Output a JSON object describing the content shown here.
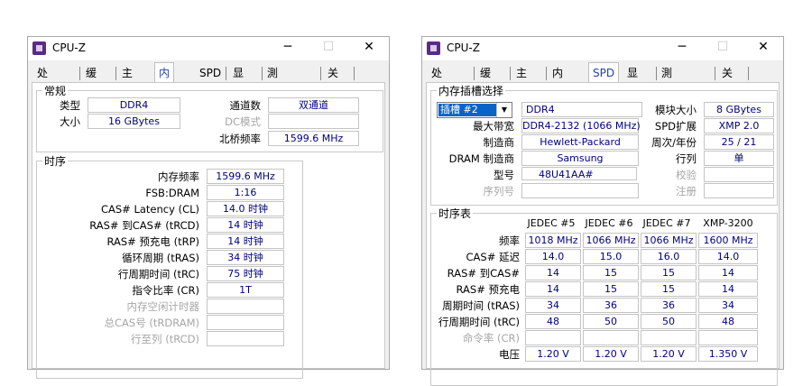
{
  "app": {
    "title": "CPU-Z"
  },
  "controls": {
    "minimize": "─",
    "maximize": "☐",
    "close": "✕"
  },
  "left": {
    "tabs": [
      "处理器",
      "缓存",
      "主板",
      "内存",
      "SPD",
      "显卡",
      "測試分數",
      "关于"
    ],
    "active_tab": "内存",
    "general": {
      "title": "常规",
      "type_label": "类型",
      "type_value": "DDR4",
      "size_label": "大小",
      "size_value": "16 GBytes",
      "channels_label": "通道数",
      "channels_value": "双通道",
      "dc_label": "DC模式",
      "dc_value": "",
      "nb_label": "北桥频率",
      "nb_value": "1599.6 MHz"
    },
    "timings": {
      "title": "时序",
      "rows": [
        {
          "label": "内存频率",
          "value": "1599.6 MHz"
        },
        {
          "label": "FSB:DRAM",
          "value": "1:16"
        },
        {
          "label": "CAS# Latency (CL)",
          "value": "14.0 时钟"
        },
        {
          "label": "RAS# 到CAS# (tRCD)",
          "value": "14 时钟"
        },
        {
          "label": "RAS# 预充电 (tRP)",
          "value": "14 时钟"
        },
        {
          "label": "循环周期 (tRAS)",
          "value": "34 时钟"
        },
        {
          "label": "行周期时间 (tRC)",
          "value": "75 时钟"
        },
        {
          "label": "指令比率 (CR)",
          "value": "1T"
        },
        {
          "label": "内存空闲计时器",
          "value": ""
        },
        {
          "label": "总CAS号 (tRDRAM)",
          "value": ""
        },
        {
          "label": "行至列 (tRCD)",
          "value": ""
        }
      ]
    }
  },
  "right": {
    "tabs": [
      "处理器",
      "缓存",
      "主板",
      "内存",
      "SPD",
      "显卡",
      "測試分數",
      "关于"
    ],
    "active_tab": "SPD",
    "slot": {
      "title": "内存插槽选择",
      "selected": "插槽 #2",
      "type_value": "DDR4",
      "module_size_label": "模块大小",
      "module_size_value": "8 GBytes",
      "bandwidth_label": "最大带宽",
      "bandwidth_value": "DDR4-2132 (1066 MHz)",
      "spd_ext_label": "SPD扩展",
      "spd_ext_value": "XMP 2.0",
      "manufacturer_label": "制造商",
      "manufacturer_value": "Hewlett-Packard",
      "week_year_label": "周次/年份",
      "week_year_value": "25 / 21",
      "dram_mfr_label": "DRAM 制造商",
      "dram_mfr_value": "Samsung",
      "ranks_label": "行列",
      "ranks_value": "单",
      "part_label": "型号",
      "part_value": "48U41AA#",
      "check_label": "校验",
      "check_value": "",
      "serial_label": "序列号",
      "serial_value": "",
      "reg_label": "注册",
      "reg_value": ""
    },
    "timing_table": {
      "title": "时序表",
      "columns": [
        "JEDEC #5",
        "JEDEC #6",
        "JEDEC #7",
        "XMP-3200"
      ],
      "rows": [
        {
          "label": "频率",
          "values": [
            "1018 MHz",
            "1066 MHz",
            "1066 MHz",
            "1600 MHz"
          ],
          "disabled": false
        },
        {
          "label": "CAS# 延迟",
          "values": [
            "14.0",
            "15.0",
            "16.0",
            "14.0"
          ],
          "disabled": false
        },
        {
          "label": "RAS# 到CAS#",
          "values": [
            "14",
            "15",
            "15",
            "14"
          ],
          "disabled": false
        },
        {
          "label": "RAS# 预充电",
          "values": [
            "14",
            "15",
            "15",
            "14"
          ],
          "disabled": false
        },
        {
          "label": "周期时间 (tRAS)",
          "values": [
            "34",
            "36",
            "36",
            "34"
          ],
          "disabled": false
        },
        {
          "label": "行周期时间 (tRC)",
          "values": [
            "48",
            "50",
            "50",
            "48"
          ],
          "disabled": false
        },
        {
          "label": "命令率 (CR)",
          "values": [
            "",
            "",
            "",
            ""
          ],
          "disabled": true
        },
        {
          "label": "电压",
          "values": [
            "1.20 V",
            "1.20 V",
            "1.20 V",
            "1.350 V"
          ],
          "disabled": false
        }
      ]
    }
  }
}
